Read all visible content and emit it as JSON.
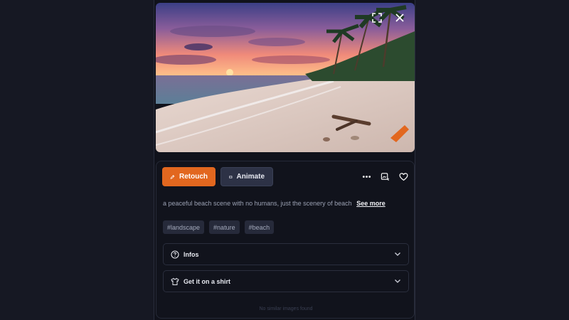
{
  "image": {
    "alt_icons": [
      "expand-icon",
      "close-icon",
      "watermark-logo"
    ]
  },
  "toolbar": {
    "retouch_label": "Retouch",
    "animate_label": "Animate",
    "more_icon": "ellipsis-icon",
    "variation_icon": "image-variation-icon",
    "favorite_icon": "heart-icon"
  },
  "description": {
    "text": "a peaceful beach scene with no humans, just the scenery of beach",
    "see_more": "See more"
  },
  "tags": [
    "#landscape",
    "#nature",
    "#beach"
  ],
  "accordions": {
    "infos": "Infos",
    "shirt": "Get it on a shirt"
  },
  "similar": {
    "empty_text": "No similar images found"
  },
  "colors": {
    "accent": "#e2671f",
    "background": "#10121b",
    "tag_bg": "#262a3a"
  }
}
